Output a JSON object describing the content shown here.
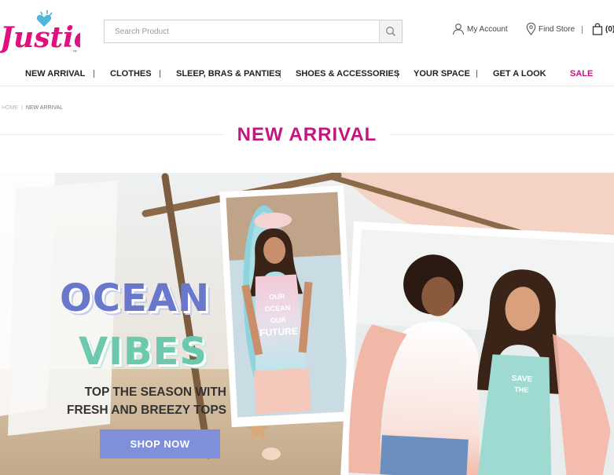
{
  "brand": {
    "name": "Justice",
    "trademark": "™"
  },
  "search": {
    "placeholder": "Search Product",
    "icon": "search-icon"
  },
  "header_links": {
    "account": {
      "label": "My Account",
      "icon": "user-icon"
    },
    "store": {
      "label": "Find Store",
      "icon": "location-pin-icon"
    },
    "cart": {
      "label": "(0)",
      "icon": "shopping-bag-icon"
    }
  },
  "nav": {
    "items": [
      {
        "label": "NEW ARRIVAL"
      },
      {
        "label": "CLOTHES"
      },
      {
        "label": "SLEEP, BRAS & PANTIES"
      },
      {
        "label": "SHOES & ACCESSORIES"
      },
      {
        "label": "YOUR SPACE"
      },
      {
        "label": "GET A LOOK"
      },
      {
        "label": "SALE"
      }
    ]
  },
  "breadcrumb": {
    "home": "HOME",
    "separator": "|",
    "current": "NEW ARRIVAL"
  },
  "page_title": "NEW ARRIVAL",
  "hero": {
    "headline_1": "OCEAN",
    "headline_2": "VIBES",
    "tagline_1": "TOP THE SEASON WITH",
    "tagline_2": "FRESH AND BREEZY TOPS",
    "cta": "SHOP NOW",
    "shirt_text_1": "OUR OCEAN OUR FUTURE",
    "shirt_text_2": "SAVE THE"
  },
  "colors": {
    "brand_pink": "#c2177e",
    "ocean_purple": "#6a78cc",
    "vibes_mint": "#6cc9ad",
    "cta_blue": "#7f8fd9"
  }
}
